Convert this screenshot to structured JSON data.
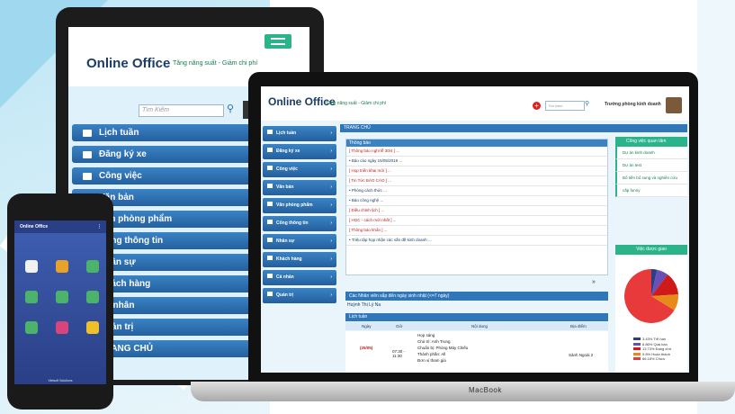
{
  "tablet": {
    "logo": "Online Office",
    "slogan": "Tăng năng suất - Giảm chi phí",
    "search_placeholder": "Tìm Kiếm",
    "menu": [
      {
        "label": "Lịch tuần",
        "icon": "calendar-icon"
      },
      {
        "label": "Đăng ký xe",
        "icon": "car-icon"
      },
      {
        "label": "Công việc",
        "icon": "task-icon"
      },
      {
        "label": "Văn bản",
        "icon": "document-icon"
      },
      {
        "label": "Văn phòng phẩm",
        "icon": "stationery-icon"
      },
      {
        "label": "Cổng thông tin",
        "icon": "portal-icon"
      },
      {
        "label": "Nhân sự",
        "icon": "people-icon"
      },
      {
        "label": "Khách hàng",
        "icon": "customer-icon"
      },
      {
        "label": "Cá nhân",
        "icon": "user-icon"
      },
      {
        "label": "Quản trị",
        "icon": "admin-icon"
      },
      {
        "label": "TRANG CHỦ",
        "icon": "home-icon"
      }
    ]
  },
  "laptop": {
    "brand": "MacBook",
    "logo": "Online Office",
    "slogan": "Tăng năng suất - Giảm chi phí",
    "search_placeholder": "Tìm kiếm",
    "user": "Trưởng phòng kinh doanh",
    "breadcrumb": "TRANG CHỦ",
    "sidebar": [
      "Lịch tuần",
      "Đăng ký xe",
      "Công việc",
      "Văn bản",
      "Văn phòng phẩm",
      "Cổng thông tin",
      "Nhân sự",
      "Khách hàng",
      "Cá nhân",
      "Quản trị"
    ],
    "notices_title": "Thông báo",
    "notices": [
      {
        "text": "[ Thông báo nghỉ lễ 30/4 ] ...",
        "color": "red"
      },
      {
        "text": "• Báo cáo ngày 15/05/2019 ...",
        "color": "blue"
      },
      {
        "text": "[ Họp triển khai mới ] ...",
        "color": "red"
      },
      {
        "text": "[ Tin Tức BÁO CÁO ] ...",
        "color": "red"
      },
      {
        "text": "• Phòng cách thức ...",
        "color": "blue"
      },
      {
        "text": "• Bảo công nghệ ...",
        "color": "blue"
      },
      {
        "text": "[ Điều chỉnh lịch ] ...",
        "color": "red"
      },
      {
        "text": "[ HỌC - cách mới nhất ] ...",
        "color": "red"
      },
      {
        "text": "[ Thông báo khẩn ] ...",
        "color": "red"
      },
      {
        "text": "• Triệu tập họp nhận các vấn đề kinh doanh ...",
        "color": "blue"
      }
    ],
    "more": "»",
    "birthday_title": "Các Nhân viên sắp đến ngày sinh nhật (<=7 ngày)",
    "birthday_name": "Huỳnh Thị Lý Na",
    "schedule_title": "Lịch tuần",
    "schedule_headers": [
      "Ngày",
      "Giờ",
      "Nội dung",
      "Địa điểm"
    ],
    "schedule_row": {
      "date": "(25/05)",
      "time": "07:30 - 11:30",
      "content": [
        "Họp sáng",
        "Chủ trì: Anh Trung",
        "Chuẩn bị: Phòng Máy Chiếu",
        "Thành phần: All",
        "Đơn vị tham gia"
      ],
      "place": "Sảnh Ngoài 2"
    },
    "tasks_title": "Công việc quan tâm",
    "tasks": [
      "Dự án kinh doanh",
      "Dự án test",
      "Bổ tiền bổ sung và nghiên cứu",
      "cấp funny"
    ],
    "chart_title": "Việc được giao",
    "legend": [
      "Trễ hạn",
      "Quá hạn",
      "Đang chờ",
      "Hoàn thành",
      "Chưa"
    ]
  },
  "chart_data": {
    "type": "pie",
    "title": "Việc được giao",
    "categories": [
      "Trễ hạn",
      "Quá hạn",
      "Đang chờ",
      "Hoàn thành",
      "Chưa"
    ],
    "values": [
      3.43,
      6.86,
      13.73,
      9.8,
      66.18
    ],
    "colors": [
      "#2a3f86",
      "#6a4fb5",
      "#d01a1a",
      "#e88a1a",
      "#e83a3a"
    ]
  },
  "phone": {
    "title": "Online Office",
    "footer": "Vietsoft Solutions"
  }
}
